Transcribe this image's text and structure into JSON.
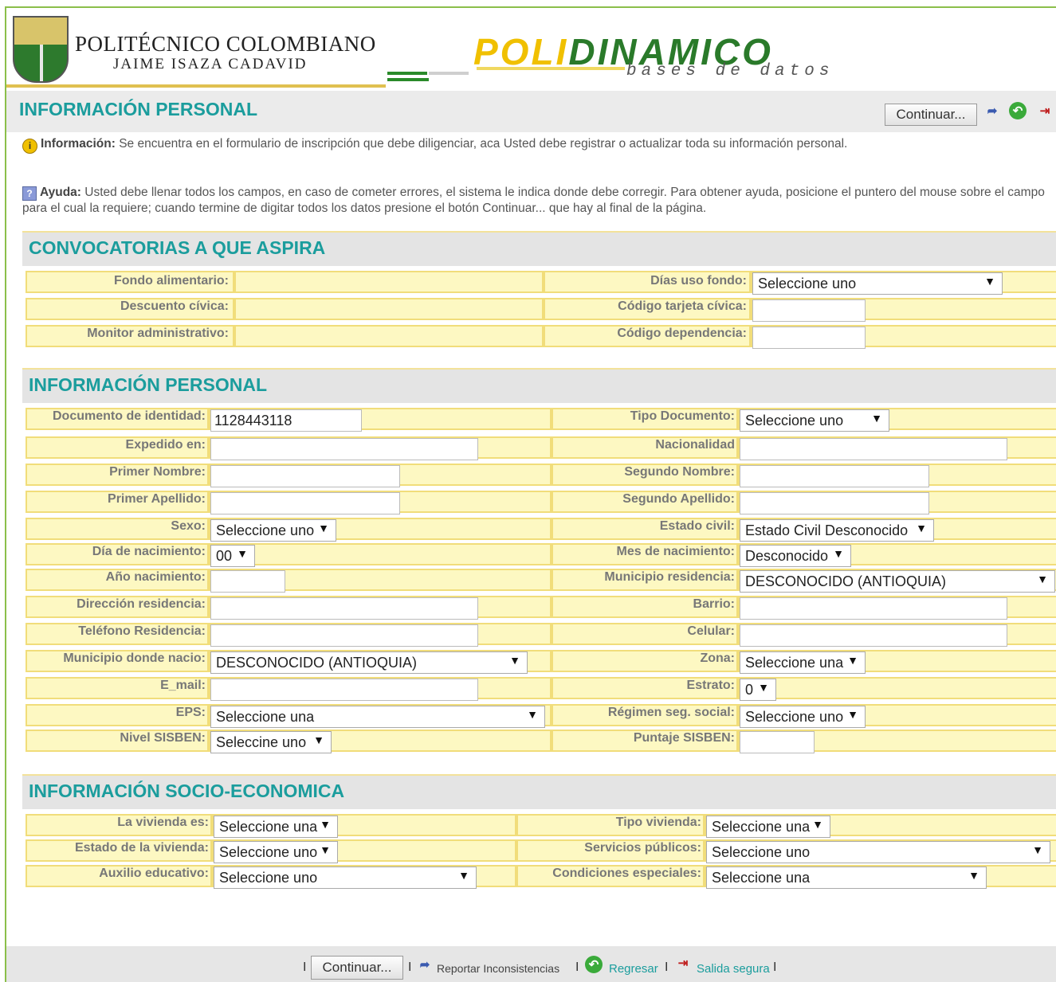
{
  "header": {
    "institution_line1": "POLITÉCNICO COLOMBIANO",
    "institution_line2": "JAIME ISAZA CADAVID",
    "brand_part1": "POLI",
    "brand_part2": "DINAMICO",
    "brand_sub": "bases de datos",
    "title": "INFORMACIÓN PERSONAL",
    "continue_label": "Continuar..."
  },
  "notices": {
    "info_label": "Información:",
    "info_text": "Se encuentra en el formulario de inscripción que debe diligenciar, aca Usted debe registrar o actualizar toda su información personal.",
    "help_label": "Ayuda:",
    "help_text": "Usted debe llenar todos los campos, en caso de cometer errores, el sistema le indica donde debe corregir. Para obtener ayuda, posicione el puntero del mouse sobre el campo para el cual la requiere; cuando termine de digitar todos los datos presione el botón Continuar... que hay al final de la página."
  },
  "convocatorias": {
    "title": "CONVOCATORIAS A QUE ASPIRA",
    "fondo_alimentario": "Fondo alimentario:",
    "descuento_civica": "Descuento cívica:",
    "monitor_administrativo": "Monitor administrativo:",
    "dias_uso_fondo": "Días uso fondo:",
    "dias_uso_fondo_value": "Seleccione uno",
    "codigo_tarjeta_civica": "Código tarjeta cívica:",
    "codigo_dependencia": "Código dependencia:"
  },
  "personal": {
    "title": "INFORMACIÓN PERSONAL",
    "documento_label": "Documento de identidad:",
    "documento_value": "1128443118",
    "tipo_documento_label": "Tipo Documento:",
    "tipo_documento_value": "Seleccione uno",
    "expedido_label": "Expedido en:",
    "nacionalidad_label": "Nacionalidad",
    "primer_nombre_label": "Primer Nombre:",
    "segundo_nombre_label": "Segundo Nombre:",
    "primer_apellido_label": "Primer Apellido:",
    "segundo_apellido_label": "Segundo Apellido:",
    "sexo_label": "Sexo:",
    "sexo_value": "Seleccione uno",
    "estado_civil_label": "Estado civil:",
    "estado_civil_value": "Estado Civil Desconocido",
    "dia_nacimiento_label": "Día de nacimiento:",
    "dia_nacimiento_value": "00",
    "mes_nacimiento_label": "Mes de nacimiento:",
    "mes_nacimiento_value": "Desconocido",
    "anio_nacimiento_label": "Año nacimiento:",
    "municipio_residencia_label": "Municipio residencia:",
    "municipio_residencia_value": "DESCONOCIDO (ANTIOQUIA)",
    "direccion_label": "Dirección residencia:",
    "barrio_label": "Barrio:",
    "telefono_label": "Teléfono Residencia:",
    "celular_label": "Celular:",
    "municipio_nacio_label": "Municipio donde nacio:",
    "municipio_nacio_value": "DESCONOCIDO (ANTIOQUIA)",
    "zona_label": "Zona:",
    "zona_value": "Seleccione una",
    "email_label": "E_mail:",
    "estrato_label": "Estrato:",
    "estrato_value": "0",
    "eps_label": "EPS:",
    "eps_value": "Seleccione una",
    "regimen_label": "Régimen seg. social:",
    "regimen_value": "Seleccione uno",
    "sisben_label": "Nivel SISBEN:",
    "sisben_value": "Seleccine uno",
    "puntaje_label": "Puntaje SISBEN:"
  },
  "socio": {
    "title": "INFORMACIÓN SOCIO-ECONOMICA",
    "vivienda_label": "La vivienda es:",
    "vivienda_value": "Seleccione una",
    "tipo_vivienda_label": "Tipo vivienda:",
    "tipo_vivienda_value": "Seleccione una",
    "estado_vivienda_label": "Estado de la vivienda:",
    "estado_vivienda_value": "Seleccione uno",
    "servicios_label": "Servicios públicos:",
    "servicios_value": "Seleccione uno",
    "auxilio_label": "Auxilio educativo:",
    "auxilio_value": "Seleccione uno",
    "condiciones_label": "Condiciones especiales:",
    "condiciones_value": "Seleccione una"
  },
  "footer": {
    "continue_label": "Continuar...",
    "reportar": "Reportar Inconsistencias",
    "regresar": "Regresar",
    "salida": "Salida segura",
    "sep": "I"
  },
  "colors": {
    "accent": "#1b9d9d",
    "cell_bg": "#fdf8c2",
    "cell_border": "#f1dd7a",
    "brand_yellow": "#f0c000",
    "brand_green": "#2a7a2a"
  }
}
